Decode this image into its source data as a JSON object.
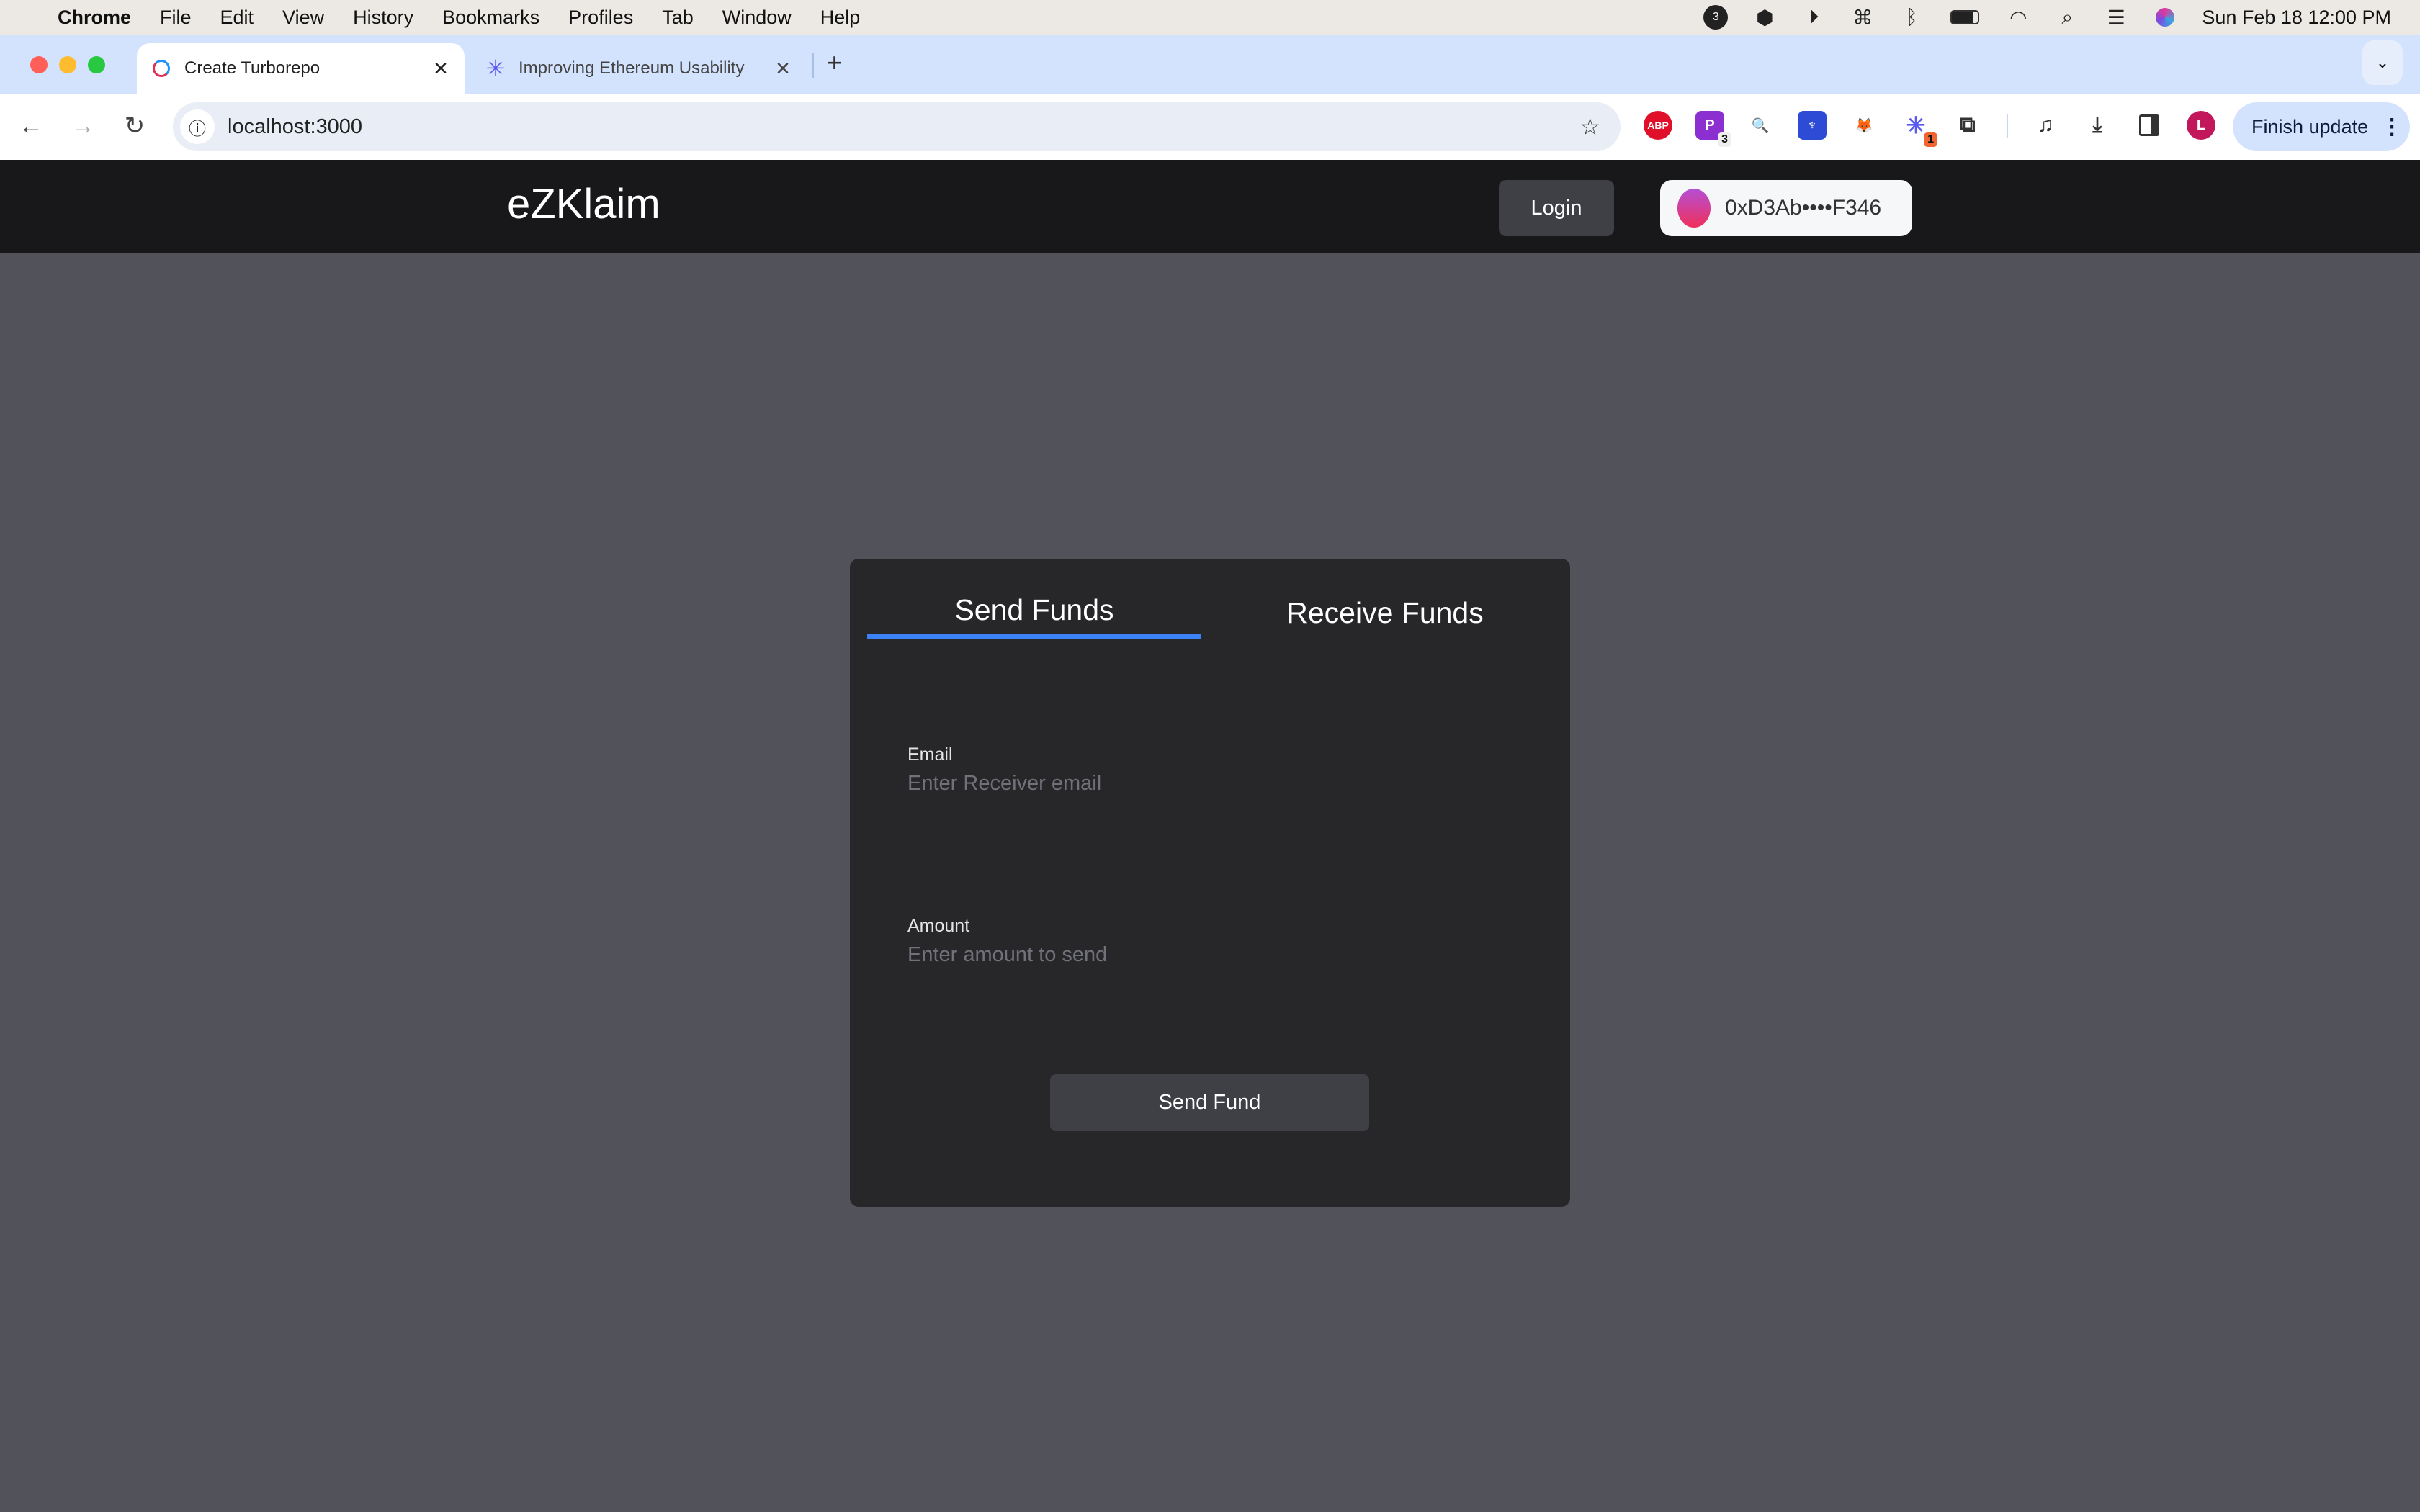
{
  "menubar": {
    "app": "Chrome",
    "items": [
      "File",
      "Edit",
      "View",
      "History",
      "Bookmarks",
      "Profiles",
      "Tab",
      "Window",
      "Help"
    ],
    "status_icons": [
      "cloud-badge-icon",
      "box-icon",
      "play-icon",
      "keyboard-icon",
      "bluetooth-icon",
      "battery-icon",
      "wifi-icon",
      "search-icon",
      "control-center-icon",
      "siri-icon"
    ],
    "clock": "Sun Feb 18  12:00 PM",
    "badge_count": "3"
  },
  "browser": {
    "tabs": [
      {
        "title": "Create Turborepo",
        "active": true
      },
      {
        "title": "Improving Ethereum Usability",
        "active": false
      }
    ],
    "url": "localhost:3000",
    "extensions": [
      {
        "name": "adblock-plus",
        "label": "ABP",
        "color": "#e0102a"
      },
      {
        "name": "extension-p",
        "label": "P",
        "color": "#8b2fd0",
        "badge": "3"
      },
      {
        "name": "magnifier",
        "label": "🔍",
        "color": "#ffffff"
      },
      {
        "name": "octopus",
        "label": "♆",
        "color": "#2e4bd6"
      },
      {
        "name": "metamask",
        "label": "🦊",
        "color": "#ffffff"
      },
      {
        "name": "spark",
        "label": "✳",
        "color": "#ffffff",
        "badge": "1"
      },
      {
        "name": "puzzle",
        "label": "⧉",
        "color": "#ffffff"
      }
    ],
    "profile_initial": "L",
    "finish_update": "Finish update"
  },
  "app": {
    "brand": "eZKlaim",
    "login": "Login",
    "wallet_address": "0xD3Ab••••F346"
  },
  "card": {
    "tabs": [
      "Send Funds",
      "Receive Funds"
    ],
    "active_tab": "Send Funds",
    "accent": "#3b82f6",
    "email_label": "Email",
    "email_placeholder": "Enter Receiver email",
    "amount_label": "Amount",
    "amount_placeholder": "Enter amount to send",
    "submit": "Send Fund"
  }
}
